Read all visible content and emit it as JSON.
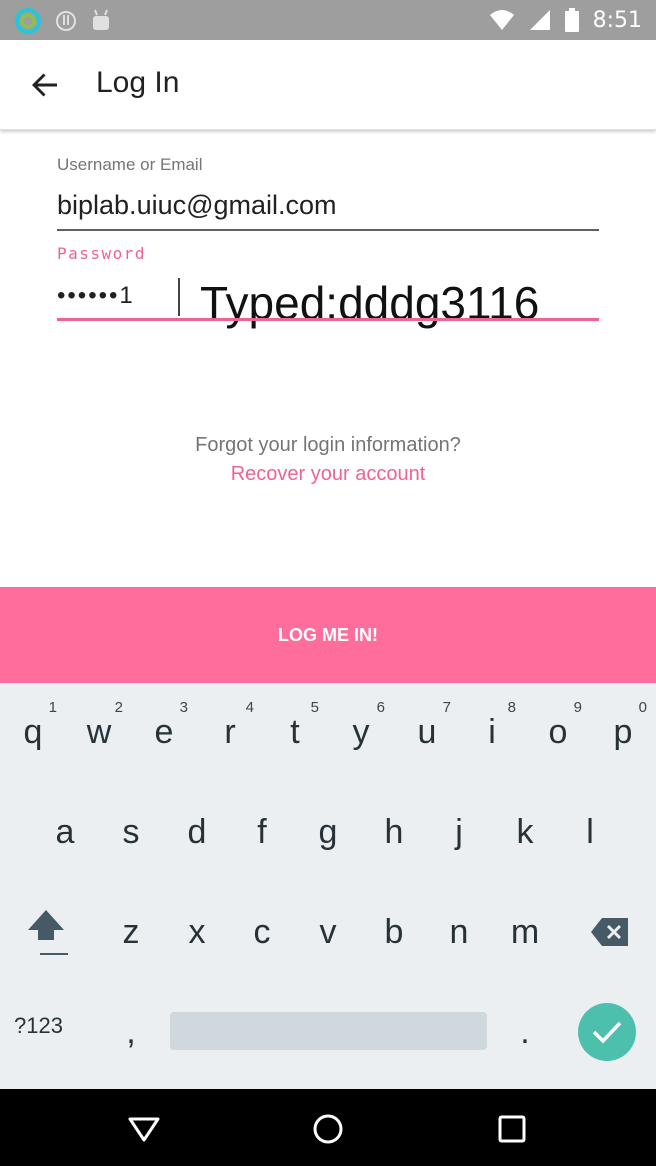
{
  "status_bar": {
    "time": "8:51",
    "icons": [
      "app-ring-icon",
      "info-circle-icon",
      "android-icon",
      "wifi-icon",
      "cellular-signal-icon",
      "battery-icon"
    ]
  },
  "app_bar": {
    "title": "Log In",
    "back_icon": "arrow-back-icon"
  },
  "form": {
    "username_label": "Username or Email",
    "username_value": "biplab.uiuc@gmail.com",
    "password_label": "Password",
    "password_value": "••••••1",
    "typed_overlay": "Typed:dddg3116"
  },
  "forgot_text": "Forgot your login information?",
  "recover_link": "Recover your account",
  "login_button": "LOG ME IN!",
  "keyboard": {
    "row1": [
      {
        "key": "q",
        "hint": "1"
      },
      {
        "key": "w",
        "hint": "2"
      },
      {
        "key": "e",
        "hint": "3"
      },
      {
        "key": "r",
        "hint": "4"
      },
      {
        "key": "t",
        "hint": "5"
      },
      {
        "key": "y",
        "hint": "6"
      },
      {
        "key": "u",
        "hint": "7"
      },
      {
        "key": "i",
        "hint": "8"
      },
      {
        "key": "o",
        "hint": "9"
      },
      {
        "key": "p",
        "hint": "0"
      }
    ],
    "row2": [
      "a",
      "s",
      "d",
      "f",
      "g",
      "h",
      "j",
      "k",
      "l"
    ],
    "row3": [
      "z",
      "x",
      "c",
      "v",
      "b",
      "n",
      "m"
    ],
    "symbols_key": "?123",
    "comma_key": ",",
    "period_key": ".",
    "accent_color": "#4dc0ad"
  },
  "colors": {
    "accent_pink": "#f06292",
    "button_pink": "#ff6d9d",
    "status_bar": "#9e9e9e",
    "keyboard_bg": "#eceff1"
  }
}
